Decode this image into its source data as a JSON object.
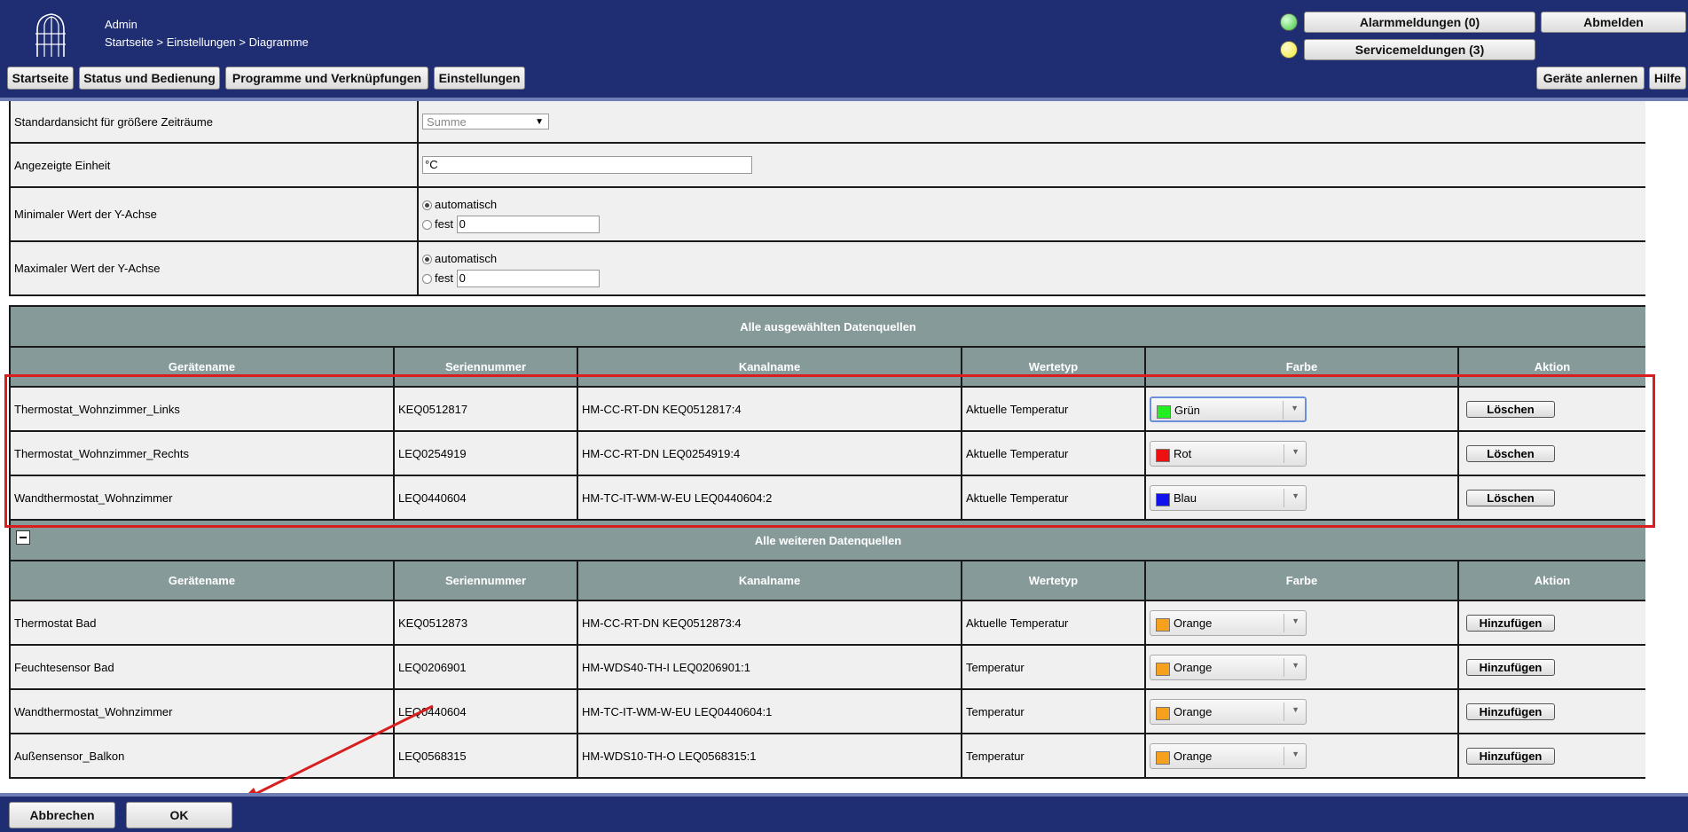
{
  "header": {
    "user": "Admin",
    "breadcrumb": "Startseite > Einstellungen > Diagramme",
    "alarm_label": "Alarmmeldungen (0)",
    "service_label": "Servicemeldungen (3)",
    "logout_label": "Abmelden",
    "alarm_led_color": "#3cc43c",
    "service_led_color": "#f2ea2b",
    "nav": [
      "Startseite",
      "Status und Bedienung",
      "Programme und Verknüpfungen",
      "Einstellungen"
    ],
    "teach_label": "Geräte anlernen",
    "help_label": "Hilfe"
  },
  "settings": {
    "default_view": {
      "label": "Standardansicht für größere Zeiträume",
      "value": "Summe"
    },
    "unit": {
      "label": "Angezeigte Einheit",
      "value": "°C"
    },
    "ymin": {
      "label": "Minimaler Wert der Y-Achse",
      "auto": "automatisch",
      "fixed": "fest",
      "value": "0"
    },
    "ymax": {
      "label": "Maximaler Wert der Y-Achse",
      "auto": "automatisch",
      "fixed": "fest",
      "value": "0"
    }
  },
  "selected": {
    "title": "Alle ausgewählten Datenquellen",
    "columns": [
      "Gerätename",
      "Seriennummer",
      "Kanalname",
      "Wertetyp",
      "Farbe",
      "Aktion"
    ],
    "rows": [
      {
        "name": "Thermostat_Wohnzimmer_Links",
        "serial": "KEQ0512817",
        "channel": "HM-CC-RT-DN KEQ0512817:4",
        "type": "Aktuelle Temperatur",
        "color": "Grün",
        "hex": "#22ee22",
        "action": "Löschen"
      },
      {
        "name": "Thermostat_Wohnzimmer_Rechts",
        "serial": "LEQ0254919",
        "channel": "HM-CC-RT-DN LEQ0254919:4",
        "type": "Aktuelle Temperatur",
        "color": "Rot",
        "hex": "#ee1111",
        "action": "Löschen"
      },
      {
        "name": "Wandthermostat_Wohnzimmer",
        "serial": "LEQ0440604",
        "channel": "HM-TC-IT-WM-W-EU LEQ0440604:2",
        "type": "Aktuelle Temperatur",
        "color": "Blau",
        "hex": "#1111ee",
        "action": "Löschen"
      }
    ]
  },
  "others": {
    "title": "Alle weiteren Datenquellen",
    "columns": [
      "Gerätename",
      "Seriennummer",
      "Kanalname",
      "Wertetyp",
      "Farbe",
      "Aktion"
    ],
    "rows": [
      {
        "name": "Thermostat Bad",
        "serial": "KEQ0512873",
        "channel": "HM-CC-RT-DN KEQ0512873:4",
        "type": "Aktuelle Temperatur",
        "color": "Orange",
        "hex": "#f5a11d",
        "action": "Hinzufügen"
      },
      {
        "name": "Feuchtesensor Bad",
        "serial": "LEQ0206901",
        "channel": "HM-WDS40-TH-I LEQ0206901:1",
        "type": "Temperatur",
        "color": "Orange",
        "hex": "#f5a11d",
        "action": "Hinzufügen"
      },
      {
        "name": "Wandthermostat_Wohnzimmer",
        "serial": "LEQ0440604",
        "channel": "HM-TC-IT-WM-W-EU LEQ0440604:1",
        "type": "Temperatur",
        "color": "Orange",
        "hex": "#f5a11d",
        "action": "Hinzufügen"
      },
      {
        "name": "Außensensor_Balkon",
        "serial": "LEQ0568315",
        "channel": "HM-WDS10-TH-O LEQ0568315:1",
        "type": "Temperatur",
        "color": "Orange",
        "hex": "#f5a11d",
        "action": "Hinzufügen"
      }
    ]
  },
  "footer": {
    "cancel_label": "Abbrechen",
    "ok_label": "OK"
  },
  "annotation_color": "#d81e1e"
}
